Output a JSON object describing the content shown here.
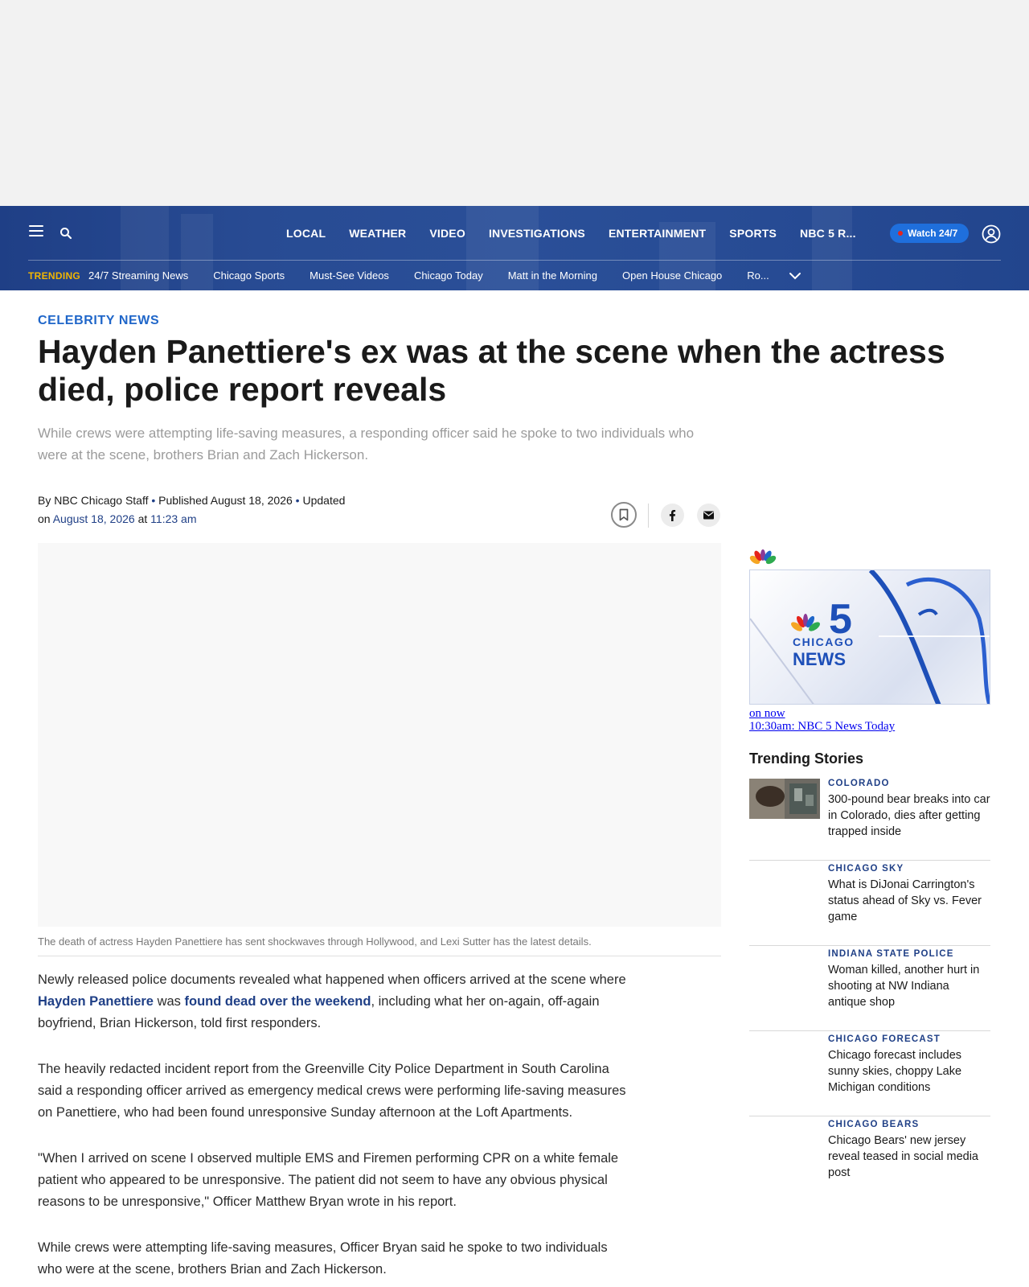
{
  "header": {
    "nav": [
      "LOCAL",
      "WEATHER",
      "VIDEO",
      "INVESTIGATIONS",
      "ENTERTAINMENT",
      "SPORTS",
      "NBC 5 R..."
    ],
    "watch_label": "Watch 24/7",
    "trending_label": "TRENDING",
    "trending_links": [
      "24/7 Streaming News",
      "Chicago Sports",
      "Must-See Videos",
      "Chicago Today",
      "Matt in the Morning",
      "Open House Chicago",
      "Ro..."
    ]
  },
  "article": {
    "category": "CELEBRITY NEWS",
    "headline": "Hayden Panettiere's ex was at the scene when the actress died, police report reveals",
    "dek": "While crews were attempting life-saving measures, a responding officer said he spoke to two individuals who were at the scene, brothers Brian and Zach Hickerson.",
    "byline": {
      "by": "By",
      "author": "NBC Chicago Staff",
      "bullet1": " • ",
      "published_label": "Published",
      "published_date": "August 18, 2026",
      "bullet2": " • ",
      "updated_label": "Updated",
      "on": "on",
      "updated_date": "August 18, 2026",
      "at": "at",
      "updated_time": "11:23 am"
    },
    "video_caption": "The death of actress Hayden Panettiere has sent shockwaves through Hollywood, and Lexi Sutter has the latest details.",
    "p1": {
      "a": "Newly released police documents revealed what happened when officers arrived at the scene where ",
      "link1": "Hayden Panettiere",
      "b": " was ",
      "link2": "found dead over the weekend",
      "c": ", including what her on-again, off-again boyfriend, Brian Hickerson, told first responders."
    },
    "p2": "The heavily redacted incident report from the Greenville City Police Department in South Carolina said a responding officer arrived as emergency medical crews were performing life-saving measures on Panettiere, who had been found unresponsive Sunday afternoon at the Loft Apartments.",
    "p3": "\"When I arrived on scene I observed multiple EMS and Firemen performing CPR on a white female patient who appeared to be unresponsive. The patient did not seem to have any obvious physical reasons to be unresponsive,\" Officer Matthew Bryan wrote in his report.",
    "p4": "While crews were attempting life-saving measures, Officer Bryan said he spoke to two individuals who were at the scene, brothers Brian and Zach Hickerson."
  },
  "sidebar": {
    "live": {
      "logo_number": "5",
      "logo_word1": "CHICAGO",
      "logo_word2": "NEWS",
      "on_now": "on now",
      "program": "10:30am: NBC 5 News Today"
    },
    "trending_title": "Trending Stories",
    "stories": [
      {
        "kicker": "COLORADO",
        "title": "300-pound bear breaks into car in Colorado, dies after getting trapped inside"
      },
      {
        "kicker": "CHICAGO SKY",
        "title": "What is DiJonai Carrington's status ahead of Sky vs. Fever game"
      },
      {
        "kicker": "INDIANA STATE POLICE",
        "title": "Woman killed, another hurt in shooting at NW Indiana antique shop"
      },
      {
        "kicker": "CHICAGO FORECAST",
        "title": "Chicago forecast includes sunny skies, choppy Lake Michigan conditions"
      },
      {
        "kicker": "CHICAGO BEARS",
        "title": "Chicago Bears' new jersey reveal teased in social media post"
      }
    ]
  },
  "colors": {
    "nav_bg": "#284b93",
    "brand_blue": "#1f3f86",
    "category_blue": "#1f66c9",
    "trending_yellow": "#f2b600",
    "watch_button": "#1f6fdc"
  }
}
